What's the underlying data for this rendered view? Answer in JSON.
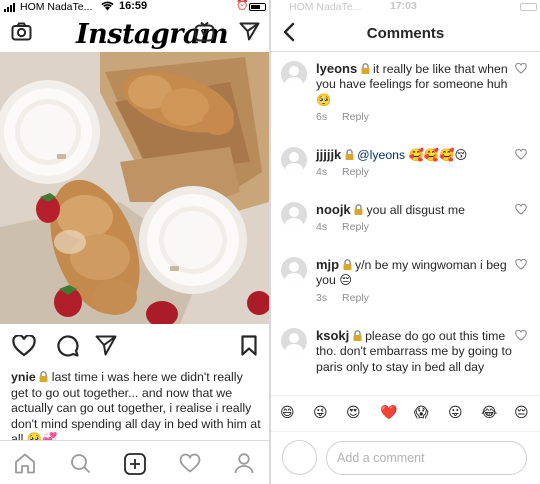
{
  "left_screen": {
    "status_bar": {
      "carrier": "HOM NadaTe...",
      "time": "16:59"
    },
    "header": {
      "logo": "Instagram",
      "camera_icon": "camera-icon",
      "igtv_icon": "igtv-icon",
      "direct_icon": "paper-plane-icon"
    },
    "post": {
      "photo_alt": "croissants-and-coffee-photo",
      "actions": {
        "like_icon": "heart-outline-icon",
        "comment_icon": "comment-bubble-icon",
        "share_icon": "paper-plane-icon",
        "save_icon": "bookmark-icon"
      },
      "caption": {
        "username": "ynie",
        "text": "last time i was here we didn't really get to go out together... and now that we actually can go out together, i realise i really don't mind spending all day in bed with him at all",
        "emojis": "🥺💞"
      }
    },
    "bottom_nav": [
      "home-icon",
      "search-icon",
      "add-post-icon",
      "activity-heart-icon",
      "profile-icon"
    ]
  },
  "right_screen": {
    "status_bar": {
      "carrier": "HOM NadaTe...",
      "time": "17:03"
    },
    "header": {
      "title": "Comments",
      "back_icon": "chevron-left-icon"
    },
    "comments": [
      {
        "username": "lyeons",
        "text": "it really be like that when you have feelings for someone huh",
        "emoji": "🥺",
        "time": "6s",
        "reply_label": "Reply"
      },
      {
        "username": "jjjjjk",
        "mention": "@lyeons",
        "text": "",
        "emoji": "🥰🥰🥰😚",
        "time": "4s",
        "reply_label": "Reply"
      },
      {
        "username": "noojk",
        "text": "you all disgust me",
        "emoji": "",
        "time": "4s",
        "reply_label": "Reply"
      },
      {
        "username": "mjp",
        "text": "y/n be my wingwoman i beg you",
        "emoji": "😔",
        "time": "3s",
        "reply_label": "Reply"
      },
      {
        "username": "ksokj",
        "text": "please do go out this time tho. don't embarrass me by going to paris only to stay in bed all day",
        "emoji": "",
        "time": "",
        "reply_label": ""
      }
    ],
    "emoji_bar": [
      "😄",
      "😜",
      "😍",
      "❤️",
      "😱",
      "😛",
      "😂",
      "😔"
    ],
    "input": {
      "placeholder": "Add a comment"
    }
  }
}
